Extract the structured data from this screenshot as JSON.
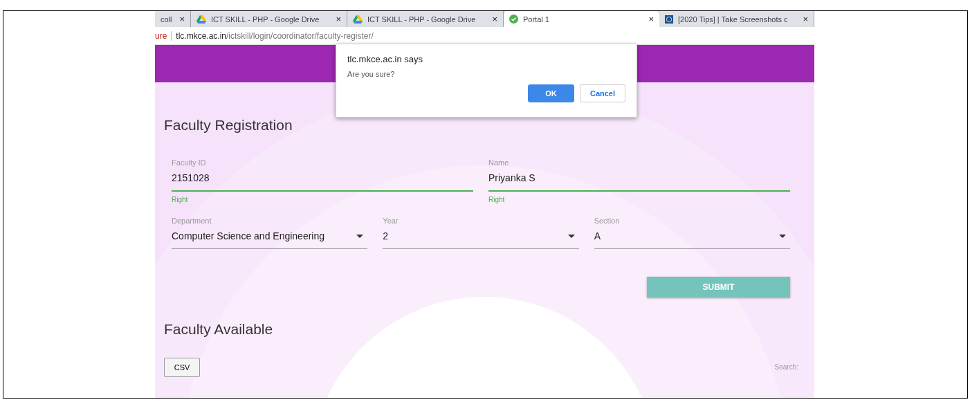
{
  "browser": {
    "tabs": [
      {
        "title": "coll",
        "kind": "plain",
        "selected": false
      },
      {
        "title": "ICT SKILL - PHP - Google Drive",
        "kind": "drive",
        "selected": false
      },
      {
        "title": "ICT SKILL - PHP - Google Drive",
        "kind": "drive",
        "selected": false
      },
      {
        "title": "Portal 1",
        "kind": "check",
        "selected": true
      },
      {
        "title": "[2020 Tips] | Take Screenshots c",
        "kind": "site",
        "selected": false
      }
    ],
    "close_glyph": "×",
    "security_label": "ure",
    "url_host": "tlc.mkce.ac.in",
    "url_path": "/ictskill/login/coordinator/faculty-register/"
  },
  "dialog": {
    "title": "tlc.mkce.ac.in says",
    "message": "Are you sure?",
    "buttons": [
      {
        "label": "OK",
        "kind": "primary"
      },
      {
        "label": "Cancel",
        "kind": "secondary"
      }
    ]
  },
  "form": {
    "title": "Faculty Registration",
    "rows": [
      [
        {
          "kind": "text",
          "label": "Faculty ID",
          "value": "2151028",
          "helper": "Right",
          "valid": true
        },
        {
          "kind": "text",
          "label": "Name",
          "value": "Priyanka S",
          "helper": "Right",
          "valid": true
        }
      ],
      [
        {
          "kind": "select",
          "label": "Department",
          "value": "Computer Science and Engineering"
        },
        {
          "kind": "select",
          "label": "Year",
          "value": "2"
        },
        {
          "kind": "select",
          "label": "Section",
          "value": "A"
        }
      ]
    ],
    "submit": "SUBMIT"
  },
  "table_section": {
    "title": "Faculty Available",
    "csv_button": "CSV",
    "search_label": "Search:"
  }
}
